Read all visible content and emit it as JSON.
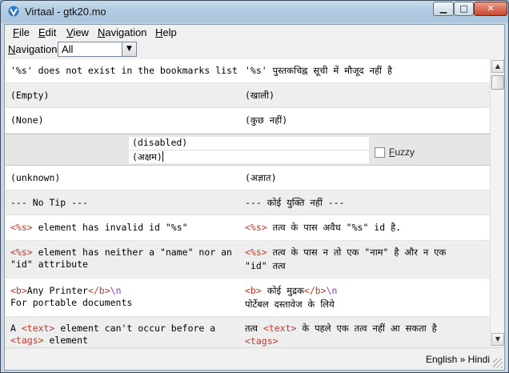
{
  "window": {
    "title": "Virtaal - gtk20.mo",
    "controls": {
      "minimize": "▁",
      "maximize": "□",
      "close": "✕"
    }
  },
  "menu": [
    {
      "key": "F",
      "rest": "ile"
    },
    {
      "key": "E",
      "rest": "dit"
    },
    {
      "key": "V",
      "rest": "iew"
    },
    {
      "key": "N",
      "rest": "avigation"
    },
    {
      "key": "H",
      "rest": "elp"
    }
  ],
  "navigation": {
    "label": "Navigation:",
    "label_key": "N",
    "label_rest": "avigation:",
    "value": "All"
  },
  "rows": [
    {
      "src": "'%s' does not exist in the bookmarks list",
      "tgt": "'%s' पुस्तकचिह्न सूची में मौजूद नहीं है"
    },
    {
      "src": "(Empty)",
      "tgt": "(खाली)"
    },
    {
      "src": "(None)",
      "tgt": "(कुछ नहीं)"
    },
    {
      "src": "(unknown)",
      "tgt": "(अज्ञात)"
    },
    {
      "src": "--- No Tip ---",
      "tgt": "--- कोई युक्ति नहीं ---"
    },
    {
      "src_tag": "<%s>",
      "src_text": " element has invalid id \"%s\"",
      "tgt_tag": "<%s>",
      "tgt_text": " तत्व के पास अवैध \"%s\" id है."
    },
    {
      "src_tag": "<%s>",
      "src_text": " element has neither a \"name\" nor an",
      "src_line2": "\"id\" attribute",
      "tgt_tag": "<%s>",
      "tgt_text": " तत्व के पास न तो एक \"नाम\" है और न एक",
      "tgt_line2": "\"id\" तत्व"
    },
    {
      "src_tag1": "<b>",
      "src_text": "Any Printer",
      "src_tag2": "</b>",
      "src_esc": "\\n",
      "src_line2": "For portable documents",
      "tgt_tag1": "<b>",
      "tgt_text": " कोई मुद्रक",
      "tgt_tag2": "</b>",
      "tgt_esc": "\\n",
      "tgt_line2": "पोर्टेबल दस्तावेज के लिये"
    },
    {
      "src_pre": "A ",
      "src_tag": "<text>",
      "src_text": " element can't occur before a",
      "src_line2_tag": "<tags>",
      "src_line2_text": " element",
      "tgt_pre": "तत्व ",
      "tgt_tag": "<text>",
      "tgt_text": " के पहले एक तत्व नहीं आ सकता है",
      "tgt_line2_tag": "<tags>"
    }
  ],
  "editor": {
    "source": "(disabled)",
    "target": "(अक्षम)",
    "fuzzy_key": "F",
    "fuzzy_rest": "uzzy",
    "fuzzy_checked": false
  },
  "status": {
    "language_pair": "English » Hindi"
  }
}
